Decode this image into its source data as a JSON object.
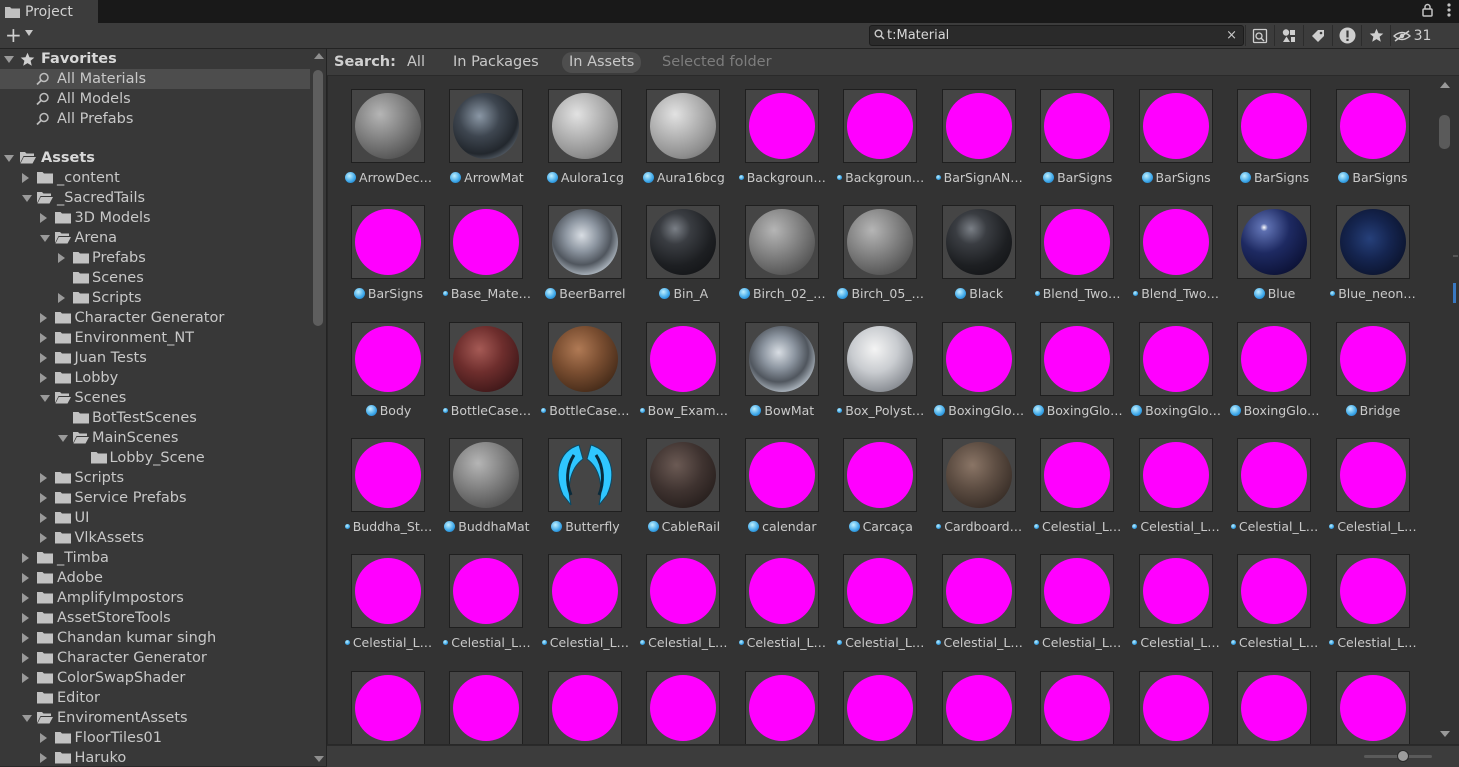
{
  "window": {
    "tab_title": "Project"
  },
  "toolbar": {
    "create_label": "+",
    "search_value": "t:Material",
    "search_placeholder": "",
    "clear_label": "×",
    "hidden_count": "31"
  },
  "search_filter": {
    "label": "Search:",
    "all": "All",
    "in_packages": "In Packages",
    "in_assets": "In Assets",
    "selected_folder": "Selected folder"
  },
  "sidebar": {
    "favorites": {
      "label": "Favorites",
      "items": [
        "All Materials",
        "All Models",
        "All Prefabs"
      ]
    },
    "assets": {
      "label": "Assets",
      "items": [
        {
          "label": "_content",
          "depth": 1,
          "state": "collapsed"
        },
        {
          "label": "_SacredTails",
          "depth": 1,
          "state": "expanded"
        },
        {
          "label": "3D Models",
          "depth": 2,
          "state": "collapsed"
        },
        {
          "label": "Arena",
          "depth": 2,
          "state": "expanded"
        },
        {
          "label": "Prefabs",
          "depth": 3,
          "state": "collapsed"
        },
        {
          "label": "Scenes",
          "depth": 3,
          "state": "leaf"
        },
        {
          "label": "Scripts",
          "depth": 3,
          "state": "collapsed"
        },
        {
          "label": "Character Generator",
          "depth": 2,
          "state": "collapsed"
        },
        {
          "label": "Environment_NT",
          "depth": 2,
          "state": "collapsed"
        },
        {
          "label": "Juan Tests",
          "depth": 2,
          "state": "collapsed"
        },
        {
          "label": "Lobby",
          "depth": 2,
          "state": "collapsed"
        },
        {
          "label": "Scenes",
          "depth": 2,
          "state": "expanded"
        },
        {
          "label": "BotTestScenes",
          "depth": 3,
          "state": "leaf"
        },
        {
          "label": "MainScenes",
          "depth": 3,
          "state": "expanded"
        },
        {
          "label": "Lobby_Scene",
          "depth": 4,
          "state": "leaf"
        },
        {
          "label": "Scripts",
          "depth": 2,
          "state": "collapsed"
        },
        {
          "label": "Service Prefabs",
          "depth": 2,
          "state": "collapsed"
        },
        {
          "label": "UI",
          "depth": 2,
          "state": "collapsed"
        },
        {
          "label": "VlkAssets",
          "depth": 2,
          "state": "collapsed"
        },
        {
          "label": "_Timba",
          "depth": 1,
          "state": "collapsed"
        },
        {
          "label": "Adobe",
          "depth": 1,
          "state": "collapsed"
        },
        {
          "label": "AmplifyImpostors",
          "depth": 1,
          "state": "collapsed"
        },
        {
          "label": "AssetStoreTools",
          "depth": 1,
          "state": "collapsed"
        },
        {
          "label": "Chandan kumar singh",
          "depth": 1,
          "state": "collapsed"
        },
        {
          "label": "Character Generator",
          "depth": 1,
          "state": "collapsed"
        },
        {
          "label": "ColorSwapShader",
          "depth": 1,
          "state": "collapsed"
        },
        {
          "label": "Editor",
          "depth": 1,
          "state": "leaf"
        },
        {
          "label": "EnviromentAssets",
          "depth": 1,
          "state": "expanded"
        },
        {
          "label": "FloorTiles01",
          "depth": 2,
          "state": "collapsed"
        },
        {
          "label": "Haruko",
          "depth": 2,
          "state": "collapsed"
        }
      ]
    }
  },
  "materials": [
    {
      "name": "ArrowDec…",
      "type": "gray",
      "icon": "big"
    },
    {
      "name": "ArrowMat",
      "type": "darkmetal",
      "icon": "big"
    },
    {
      "name": "Aulora1cg",
      "type": "lightgray",
      "icon": "big"
    },
    {
      "name": "Aura16bcg",
      "type": "lightgray",
      "icon": "big"
    },
    {
      "name": "Backgroun…",
      "type": "magenta",
      "icon": "small"
    },
    {
      "name": "Backgroun…",
      "type": "magenta",
      "icon": "small"
    },
    {
      "name": "BarSignAN…",
      "type": "magenta",
      "icon": "small"
    },
    {
      "name": "BarSigns",
      "type": "magenta",
      "icon": "big"
    },
    {
      "name": "BarSigns",
      "type": "magenta",
      "icon": "big"
    },
    {
      "name": "BarSigns",
      "type": "magenta",
      "icon": "big"
    },
    {
      "name": "BarSigns",
      "type": "magenta",
      "icon": "big"
    },
    {
      "name": "BarSigns",
      "type": "magenta",
      "icon": "big"
    },
    {
      "name": "Base_Mate…",
      "type": "magenta",
      "icon": "small"
    },
    {
      "name": "BeerBarrel",
      "type": "chrome",
      "icon": "big"
    },
    {
      "name": "Bin_A",
      "type": "black",
      "icon": "big"
    },
    {
      "name": "Birch_02_…",
      "type": "gray",
      "icon": "big"
    },
    {
      "name": "Birch_05_…",
      "type": "gray",
      "icon": "big"
    },
    {
      "name": "Black",
      "type": "black",
      "icon": "big"
    },
    {
      "name": "Blend_Two…",
      "type": "magenta",
      "icon": "small"
    },
    {
      "name": "Blend_Two…",
      "type": "magenta",
      "icon": "small"
    },
    {
      "name": "Blue",
      "type": "blue",
      "icon": "big"
    },
    {
      "name": "Blue_neon…",
      "type": "blueneon",
      "icon": "small"
    },
    {
      "name": "Body",
      "type": "magenta",
      "icon": "big"
    },
    {
      "name": "BottleCase…",
      "type": "redwood",
      "icon": "small"
    },
    {
      "name": "BottleCase…",
      "type": "brownwood",
      "icon": "small"
    },
    {
      "name": "Bow_Exam…",
      "type": "magenta",
      "icon": "small"
    },
    {
      "name": "BowMat",
      "type": "chrome",
      "icon": "big"
    },
    {
      "name": "Box_Polyst…",
      "type": "whitebox",
      "icon": "small"
    },
    {
      "name": "BoxingGlo…",
      "type": "magenta",
      "icon": "big"
    },
    {
      "name": "BoxingGlo…",
      "type": "magenta",
      "icon": "big"
    },
    {
      "name": "BoxingGlo…",
      "type": "magenta",
      "icon": "big"
    },
    {
      "name": "BoxingGlo…",
      "type": "magenta",
      "icon": "big"
    },
    {
      "name": "Bridge",
      "type": "magenta",
      "icon": "big"
    },
    {
      "name": "Buddha_St…",
      "type": "magenta",
      "icon": "small"
    },
    {
      "name": "BuddhaMat",
      "type": "gray",
      "icon": "big"
    },
    {
      "name": "Butterfly",
      "type": "butterfly",
      "icon": "big"
    },
    {
      "name": "CableRail",
      "type": "darkwood",
      "icon": "big"
    },
    {
      "name": "calendar",
      "type": "magenta",
      "icon": "big"
    },
    {
      "name": "Carcaça",
      "type": "magenta",
      "icon": "big"
    },
    {
      "name": "Cardboard…",
      "type": "cardboard",
      "icon": "small"
    },
    {
      "name": "Celestial_L…",
      "type": "magenta",
      "icon": "small"
    },
    {
      "name": "Celestial_L…",
      "type": "magenta",
      "icon": "small"
    },
    {
      "name": "Celestial_L…",
      "type": "magenta",
      "icon": "small"
    },
    {
      "name": "Celestial_L…",
      "type": "magenta",
      "icon": "small"
    },
    {
      "name": "Celestial_L…",
      "type": "magenta",
      "icon": "small"
    },
    {
      "name": "Celestial_L…",
      "type": "magenta",
      "icon": "small"
    },
    {
      "name": "Celestial_L…",
      "type": "magenta",
      "icon": "small"
    },
    {
      "name": "Celestial_L…",
      "type": "magenta",
      "icon": "small"
    },
    {
      "name": "Celestial_L…",
      "type": "magenta",
      "icon": "small"
    },
    {
      "name": "Celestial_L…",
      "type": "magenta",
      "icon": "small"
    },
    {
      "name": "Celestial_L…",
      "type": "magenta",
      "icon": "small"
    },
    {
      "name": "Celestial_L…",
      "type": "magenta",
      "icon": "small"
    },
    {
      "name": "Celestial_L…",
      "type": "magenta",
      "icon": "small"
    },
    {
      "name": "Celestial_L…",
      "type": "magenta",
      "icon": "small"
    },
    {
      "name": "Celestial_L…",
      "type": "magenta",
      "icon": "small"
    },
    {
      "name": "",
      "type": "magenta",
      "icon": "none"
    },
    {
      "name": "",
      "type": "magenta",
      "icon": "none"
    },
    {
      "name": "",
      "type": "magenta",
      "icon": "none"
    },
    {
      "name": "",
      "type": "magenta",
      "icon": "none"
    },
    {
      "name": "",
      "type": "magenta",
      "icon": "none"
    },
    {
      "name": "",
      "type": "magenta",
      "icon": "none"
    },
    {
      "name": "",
      "type": "magenta",
      "icon": "none"
    },
    {
      "name": "",
      "type": "magenta",
      "icon": "none"
    },
    {
      "name": "",
      "type": "magenta",
      "icon": "none"
    },
    {
      "name": "",
      "type": "magenta",
      "icon": "none"
    },
    {
      "name": "",
      "type": "magenta",
      "icon": "none"
    }
  ],
  "colors": {
    "missing_shader": "#ff00ff",
    "selection": "#4d4d4d",
    "accent_blue": "#3a79c2"
  },
  "zoom_slider": {
    "value": 0.5
  }
}
